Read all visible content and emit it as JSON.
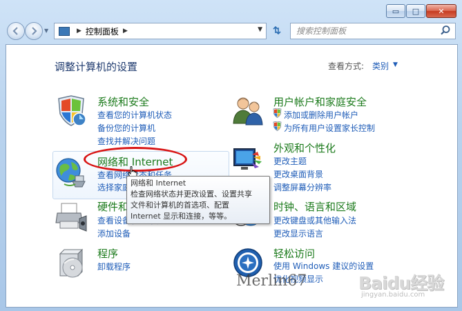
{
  "window": {
    "caption": {
      "minimize": "▭",
      "maximize": "□",
      "close": "✕"
    }
  },
  "nav": {
    "back_icon": "arrow-left-icon",
    "forward_icon": "arrow-right-icon",
    "address": {
      "path": "控制面板"
    },
    "search": {
      "placeholder": "搜索控制面板"
    }
  },
  "header": {
    "title": "调整计算机的设置",
    "view_by_label": "查看方式:",
    "view_by_value": "类别"
  },
  "categories": [
    {
      "title": "系统和安全",
      "links": [
        "查看您的计算机状态",
        "备份您的计算机",
        "查找并解决问题"
      ]
    },
    {
      "title": "网络和 Internet",
      "links": [
        "查看网络状态和任务",
        "选择家庭组和共享选项"
      ]
    },
    {
      "title": "硬件和声音",
      "links": [
        "查看设备和打印机",
        "添加设备"
      ]
    },
    {
      "title": "程序",
      "links": [
        "卸载程序"
      ]
    },
    {
      "title": "用户帐户和家庭安全",
      "links": [
        "添加或删除用户帐户",
        "为所有用户设置家长控制"
      ]
    },
    {
      "title": "外观和个性化",
      "links": [
        "更改主题",
        "更改桌面背景",
        "调整屏幕分辨率"
      ]
    },
    {
      "title": "时钟、语言和区域",
      "links": [
        "更改键盘或其他输入法",
        "更改显示语言"
      ]
    },
    {
      "title": "轻松访问",
      "links": [
        "使用 Windows 建议的设置",
        "优化视频显示"
      ]
    }
  ],
  "tooltip": {
    "lines": [
      "网络和 Internet",
      "检查网络状态并更改设置、设置共享",
      "文件和计算机的首选项、配置",
      "Internet 显示和连接，等等。"
    ]
  },
  "watermark": {
    "text": "Merlin67"
  },
  "baidu": {
    "logo_text": "Baidu经验",
    "url": "jingyan.baidu.com"
  },
  "colors": {
    "title_green": "#1b7a1b",
    "link_blue": "#1f5db8",
    "annotation_red": "#d81414"
  }
}
